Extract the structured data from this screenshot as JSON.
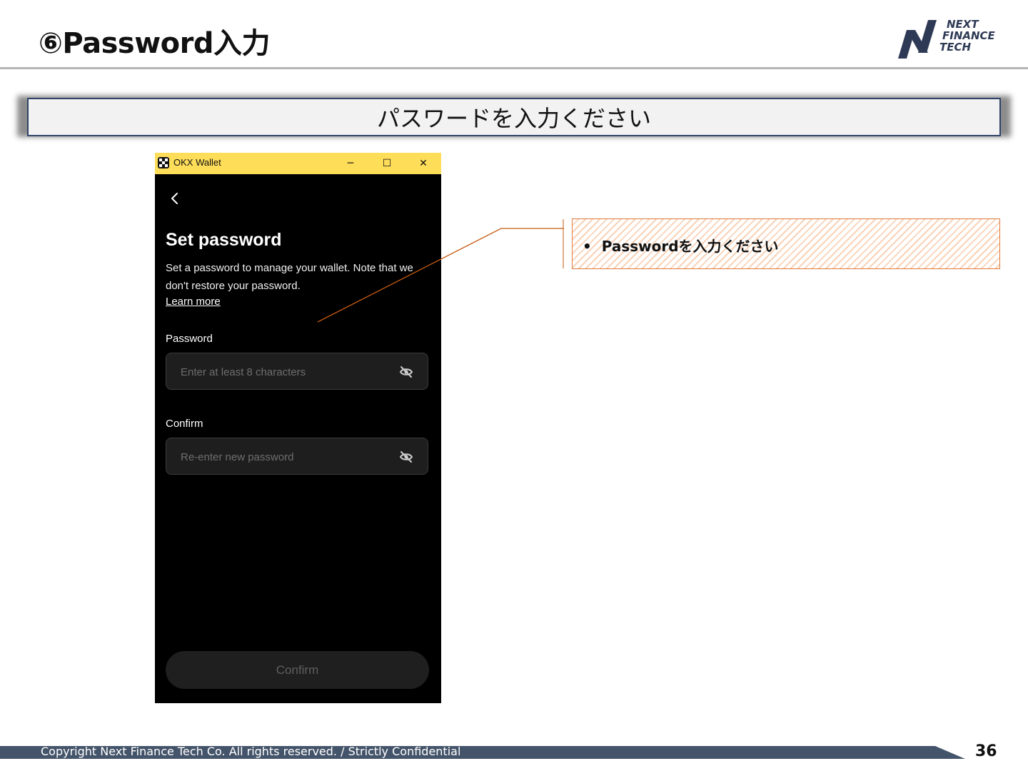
{
  "slide": {
    "title": "⑥Password入力",
    "banner": "パスワードを入力ください",
    "page_number": "36",
    "footer": "Copyright Next Finance Tech Co. All rights reserved. / Strictly Confidential"
  },
  "logo": {
    "lines": [
      "NEXT",
      "FINANCE",
      "TECH"
    ],
    "color": "#2e3a55"
  },
  "okx_window": {
    "app_title": "OKX Wallet",
    "controls": {
      "minimize": "─",
      "maximize": "☐",
      "close": "✕"
    },
    "heading": "Set password",
    "description": "Set a password to manage your wallet. Note that we don't restore your password.",
    "learn_more": "Learn more",
    "password": {
      "label": "Password",
      "placeholder": "Enter at least 8 characters",
      "value": ""
    },
    "confirm_field": {
      "label": "Confirm",
      "placeholder": "Re-enter new password",
      "value": ""
    },
    "confirm_button": "Confirm",
    "titlebar_color": "#fedd59"
  },
  "callout": {
    "bullet": "•",
    "text": "Passwordを入力ください",
    "border_color": "#e07a3a"
  },
  "colors": {
    "banner_border": "#2f4268",
    "footer_bar": "#44546a"
  }
}
